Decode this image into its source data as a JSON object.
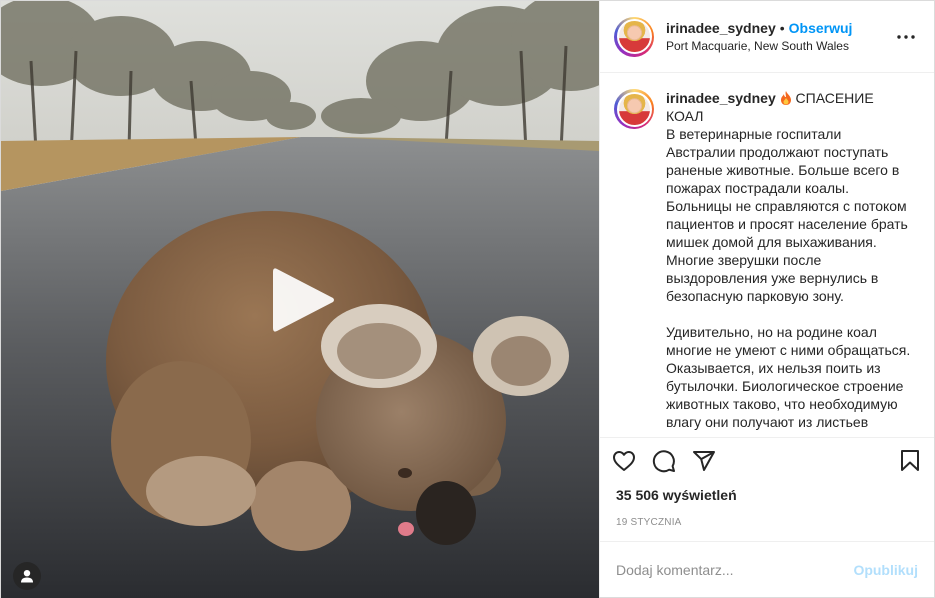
{
  "post": {
    "username": "irinadee_sydney",
    "separator": "•",
    "follow_label": "Obserwuj",
    "location": "Port Macquarie, New South Wales",
    "caption_user": "irinadee_sydney",
    "caption_title": "СПАСЕНИЕ КОАЛ",
    "caption_text": "В ветеринарные госпитали Австралии продолжают поступать раненые животные. Больше всего в пожарах пострадали коалы. Больницы не справляются с потоком пациентов и просят население брать мишек домой для выхаживания. Многие зверушки после выздоровления уже вернулись в безопасную парковую зону.\n\nУдивительно, но на родине коал многие не умеют с ними обращаться. Оказывается, их нельзя поить из бутылочки. Биологическое строение животных таково, что необходимую влагу они получают из листьев эвкалипта или, при",
    "views": "35 506 wyświetleń",
    "date": "19 stycznia"
  },
  "comment": {
    "placeholder": "Dodaj komentarz...",
    "publish_label": "Opublikuj"
  },
  "icons": {
    "caption_emoji": "fire-icon",
    "like": "heart-icon",
    "comment": "comment-icon",
    "share": "paper-plane-icon",
    "save": "bookmark-icon",
    "more": "ellipsis-icon",
    "play": "play-icon",
    "tags": "user-icon"
  },
  "colors": {
    "link_blue": "#0095f6",
    "publish_disabled": "#b2dffc",
    "muted": "#8e8e8e"
  }
}
